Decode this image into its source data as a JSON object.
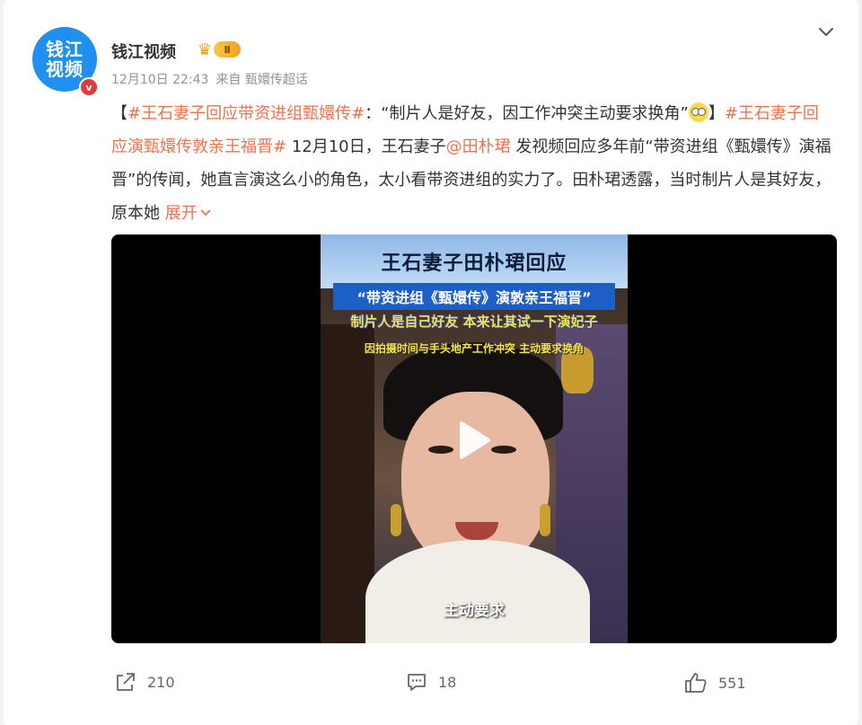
{
  "account": {
    "avatar_text": "钱江视频",
    "verified_mark": "v",
    "name": "钱江视频",
    "vip_level": "Ⅱ",
    "time": "12月10日 22:43",
    "source": "来自 甄嬛传超话"
  },
  "post": {
    "bracket_open": "【",
    "tag1": "#王石妻子回应带资进组甄嬛传#",
    "quote": "：“制片人是好友，因工作冲突主动要求换角”",
    "bracket_close": "】",
    "tag2": "#王石妻子回应演甄嬛传敦亲王福晋#",
    "text1": " 12月10日，王石妻子",
    "mention": "@田朴珺",
    "text2": " 发视频回应多年前“带资进组《甄嬛传》演福晋”的传闻，她直言演这么小的角色，太小看带资进组的实力了。田朴珺透露，当时制片人是其好友，原本她 ",
    "expand_label": "展开"
  },
  "video": {
    "title": "王石妻子田朴珺回应",
    "banner": "“带资进组《甄嬛传》演敦亲王福晋”",
    "caption1": "制片人是自己好友 本来让其试一下演妃子",
    "caption2": "因拍摄时间与手头地产工作冲突 主动要求换角",
    "subtitle": "主动要求"
  },
  "actions": {
    "share_count": "210",
    "comment_count": "18",
    "like_count": "551"
  },
  "colors": {
    "link": "#eb7350",
    "avatar_bg": "#1f8ff0",
    "verified": "#e4393c"
  }
}
